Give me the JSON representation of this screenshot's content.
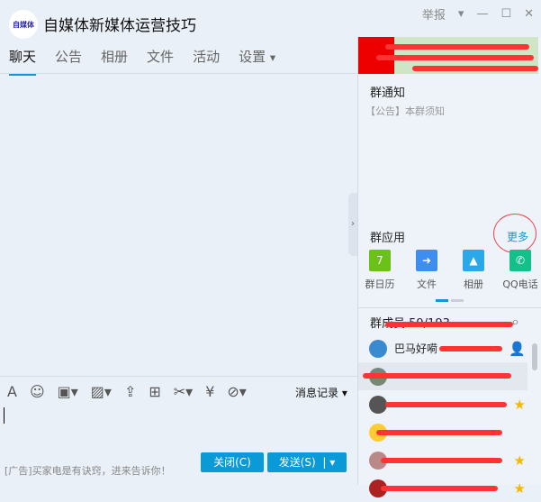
{
  "header": {
    "logo_text": "自媒体",
    "title": "自媒体新媒体运营技巧",
    "report": "举报"
  },
  "tabs": [
    "聊天",
    "公告",
    "相册",
    "文件",
    "活动",
    "设置"
  ],
  "notice": {
    "title": "群通知",
    "body": "【公告】本群须知"
  },
  "apps": {
    "title": "群应用",
    "more": "更多",
    "items": [
      {
        "label": "群日历",
        "color": "#6cc118"
      },
      {
        "label": "文件",
        "color": "#3d8ef0"
      },
      {
        "label": "相册",
        "color": "#2aa8e8"
      },
      {
        "label": "QQ电话",
        "color": "#13c08a"
      }
    ]
  },
  "members": {
    "title": "群成员 59/193",
    "first": "巴马好嗬"
  },
  "input": {
    "history": "消息记录",
    "ad": "[广告]买家电是有诀窍，进来告诉你！",
    "close": "关闭(C)",
    "send": "发送(S)"
  }
}
